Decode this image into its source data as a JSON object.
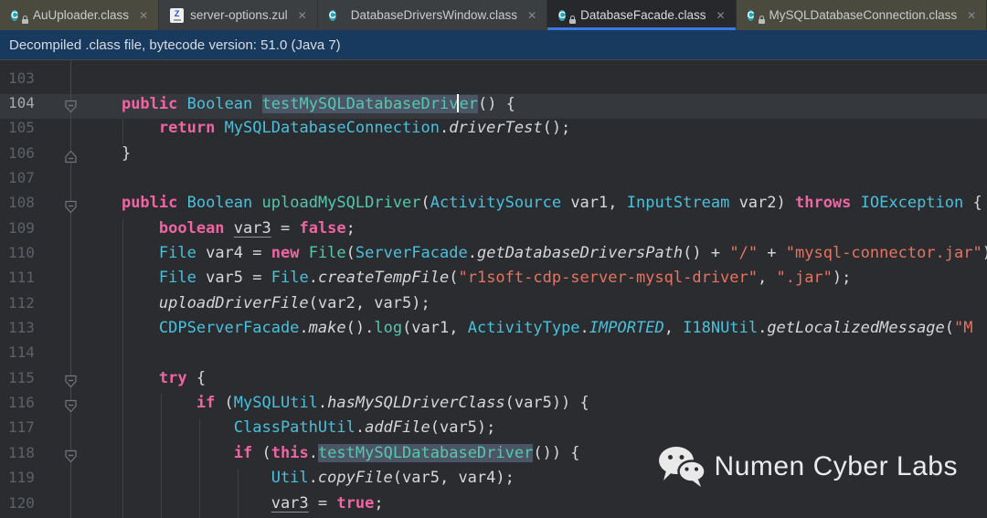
{
  "colors": {
    "accent_blue": "#3b79e5",
    "banner_bg": "#173a5e",
    "editor_bg": "#2a2c30",
    "library_tab_bg": "#4b4a3e",
    "keyword": "#ef64a3",
    "class_name": "#4ac0dc",
    "method_decl": "#53c7ab",
    "string": "#e8735f",
    "identifier_highlight_bg": "#4c5565"
  },
  "tabs": [
    {
      "label": "AuUploader.class",
      "icon": "class-locked-icon",
      "library": true,
      "active": false,
      "close": "✕"
    },
    {
      "label": "server-options.zul",
      "icon": "zul-file-icon",
      "library": false,
      "active": false,
      "close": "✕"
    },
    {
      "label": "DatabaseDriversWindow.class",
      "icon": "class-icon",
      "library": false,
      "active": false,
      "close": "✕"
    },
    {
      "label": "DatabaseFacade.class",
      "icon": "class-locked-icon",
      "library": false,
      "active": true,
      "close": "✕"
    },
    {
      "label": "MySQLDatabaseConnection.class",
      "icon": "class-locked-icon",
      "library": true,
      "active": false,
      "close": "✕"
    }
  ],
  "banner": {
    "text": "Decompiled .class file, bytecode version: 51.0 (Java 7)"
  },
  "editor": {
    "caret_line": 104,
    "first_visible_line": 102,
    "lines": [
      {
        "num": "",
        "tokens": [
          [
            "plain",
            "    }"
          ]
        ]
      },
      {
        "num": "103",
        "tokens": []
      },
      {
        "num": "104",
        "tokens": [
          [
            "plain",
            "    "
          ],
          [
            "kw",
            "public"
          ],
          [
            "plain",
            " "
          ],
          [
            "cls",
            "Boolean"
          ],
          [
            "plain",
            " "
          ],
          [
            "hl",
            "testMySQLDatabaseDriv"
          ],
          [
            "caret",
            ""
          ],
          [
            "hl",
            "er"
          ],
          [
            "plain",
            "() {"
          ]
        ]
      },
      {
        "num": "105",
        "tokens": [
          [
            "plain",
            "        "
          ],
          [
            "kw",
            "return"
          ],
          [
            "plain",
            " "
          ],
          [
            "cls",
            "MySQLDatabaseConnection"
          ],
          [
            "plain",
            "."
          ],
          [
            "call",
            "driverTest"
          ],
          [
            "plain",
            "();"
          ]
        ]
      },
      {
        "num": "106",
        "tokens": [
          [
            "plain",
            "    }"
          ]
        ]
      },
      {
        "num": "107",
        "tokens": []
      },
      {
        "num": "108",
        "tokens": [
          [
            "plain",
            "    "
          ],
          [
            "kw",
            "public"
          ],
          [
            "plain",
            " "
          ],
          [
            "cls",
            "Boolean"
          ],
          [
            "plain",
            " "
          ],
          [
            "mdecl",
            "uploadMySQLDriver"
          ],
          [
            "plain",
            "("
          ],
          [
            "cls",
            "ActivitySource"
          ],
          [
            "plain",
            " var1, "
          ],
          [
            "cls",
            "InputStream"
          ],
          [
            "plain",
            " var2) "
          ],
          [
            "kw",
            "throws"
          ],
          [
            "plain",
            " "
          ],
          [
            "cls",
            "IOException"
          ],
          [
            "plain",
            " {"
          ]
        ]
      },
      {
        "num": "109",
        "tokens": [
          [
            "plain",
            "        "
          ],
          [
            "kw",
            "boolean"
          ],
          [
            "plain",
            " "
          ],
          [
            "varu",
            "var3"
          ],
          [
            "plain",
            " = "
          ],
          [
            "kw",
            "false"
          ],
          [
            "plain",
            ";"
          ]
        ]
      },
      {
        "num": "110",
        "tokens": [
          [
            "plain",
            "        "
          ],
          [
            "cls",
            "File"
          ],
          [
            "plain",
            " var4 = "
          ],
          [
            "kw",
            "new"
          ],
          [
            "plain",
            " "
          ],
          [
            "mdecl",
            "File"
          ],
          [
            "plain",
            "("
          ],
          [
            "cls",
            "ServerFacade"
          ],
          [
            "plain",
            "."
          ],
          [
            "call",
            "getDatabaseDriversPath"
          ],
          [
            "plain",
            "() + "
          ],
          [
            "str",
            "\"/\""
          ],
          [
            "plain",
            " + "
          ],
          [
            "str",
            "\"mysql-connector.jar\""
          ],
          [
            "plain",
            ");"
          ]
        ]
      },
      {
        "num": "111",
        "tokens": [
          [
            "plain",
            "        "
          ],
          [
            "cls",
            "File"
          ],
          [
            "plain",
            " var5 = "
          ],
          [
            "cls",
            "File"
          ],
          [
            "plain",
            "."
          ],
          [
            "call",
            "createTempFile"
          ],
          [
            "plain",
            "("
          ],
          [
            "str",
            "\"r1soft-cdp-server-mysql-driver\""
          ],
          [
            "plain",
            ", "
          ],
          [
            "str",
            "\".jar\""
          ],
          [
            "plain",
            ");"
          ]
        ]
      },
      {
        "num": "112",
        "tokens": [
          [
            "plain",
            "        "
          ],
          [
            "call",
            "uploadDriverFile"
          ],
          [
            "plain",
            "(var2, var5);"
          ]
        ]
      },
      {
        "num": "113",
        "tokens": [
          [
            "plain",
            "        "
          ],
          [
            "cls",
            "CDPServerFacade"
          ],
          [
            "plain",
            "."
          ],
          [
            "call",
            "make"
          ],
          [
            "plain",
            "()."
          ],
          [
            "mdecl",
            "log"
          ],
          [
            "plain",
            "(var1, "
          ],
          [
            "cls",
            "ActivityType"
          ],
          [
            "plain",
            "."
          ],
          [
            "enum",
            "IMPORTED"
          ],
          [
            "plain",
            ", "
          ],
          [
            "cls",
            "I18NUtil"
          ],
          [
            "plain",
            "."
          ],
          [
            "call",
            "getLocalizedMessage"
          ],
          [
            "plain",
            "("
          ],
          [
            "str",
            "\"M"
          ]
        ]
      },
      {
        "num": "114",
        "tokens": []
      },
      {
        "num": "115",
        "tokens": [
          [
            "plain",
            "        "
          ],
          [
            "kw",
            "try"
          ],
          [
            "plain",
            " {"
          ]
        ]
      },
      {
        "num": "116",
        "tokens": [
          [
            "plain",
            "            "
          ],
          [
            "kw",
            "if"
          ],
          [
            "plain",
            " ("
          ],
          [
            "cls",
            "MySQLUtil"
          ],
          [
            "plain",
            "."
          ],
          [
            "call",
            "hasMySQLDriverClass"
          ],
          [
            "plain",
            "(var5)) {"
          ]
        ]
      },
      {
        "num": "117",
        "tokens": [
          [
            "plain",
            "                "
          ],
          [
            "cls",
            "ClassPathUtil"
          ],
          [
            "plain",
            "."
          ],
          [
            "call",
            "addFile"
          ],
          [
            "plain",
            "(var5);"
          ]
        ]
      },
      {
        "num": "118",
        "tokens": [
          [
            "plain",
            "                "
          ],
          [
            "kw",
            "if"
          ],
          [
            "plain",
            " ("
          ],
          [
            "kw",
            "this"
          ],
          [
            "plain",
            "."
          ],
          [
            "hl",
            "testMySQLDatabaseDriver"
          ],
          [
            "plain",
            "()) {"
          ]
        ]
      },
      {
        "num": "119",
        "tokens": [
          [
            "plain",
            "                    "
          ],
          [
            "cls",
            "Util"
          ],
          [
            "plain",
            "."
          ],
          [
            "call",
            "copyFile"
          ],
          [
            "plain",
            "(var5, var4);"
          ]
        ]
      },
      {
        "num": "120",
        "tokens": [
          [
            "plain",
            "                    "
          ],
          [
            "varu",
            "var3"
          ],
          [
            "plain",
            " = "
          ],
          [
            "kw",
            "true"
          ],
          [
            "plain",
            ";"
          ]
        ]
      }
    ],
    "fold_markers": [
      {
        "line": 104,
        "dir": "down"
      },
      {
        "line": 106,
        "dir": "up"
      },
      {
        "line": 108,
        "dir": "down"
      },
      {
        "line": 115,
        "dir": "down"
      },
      {
        "line": 116,
        "dir": "down"
      },
      {
        "line": 118,
        "dir": "down"
      }
    ]
  },
  "watermark": {
    "text": "Numen Cyber Labs"
  }
}
